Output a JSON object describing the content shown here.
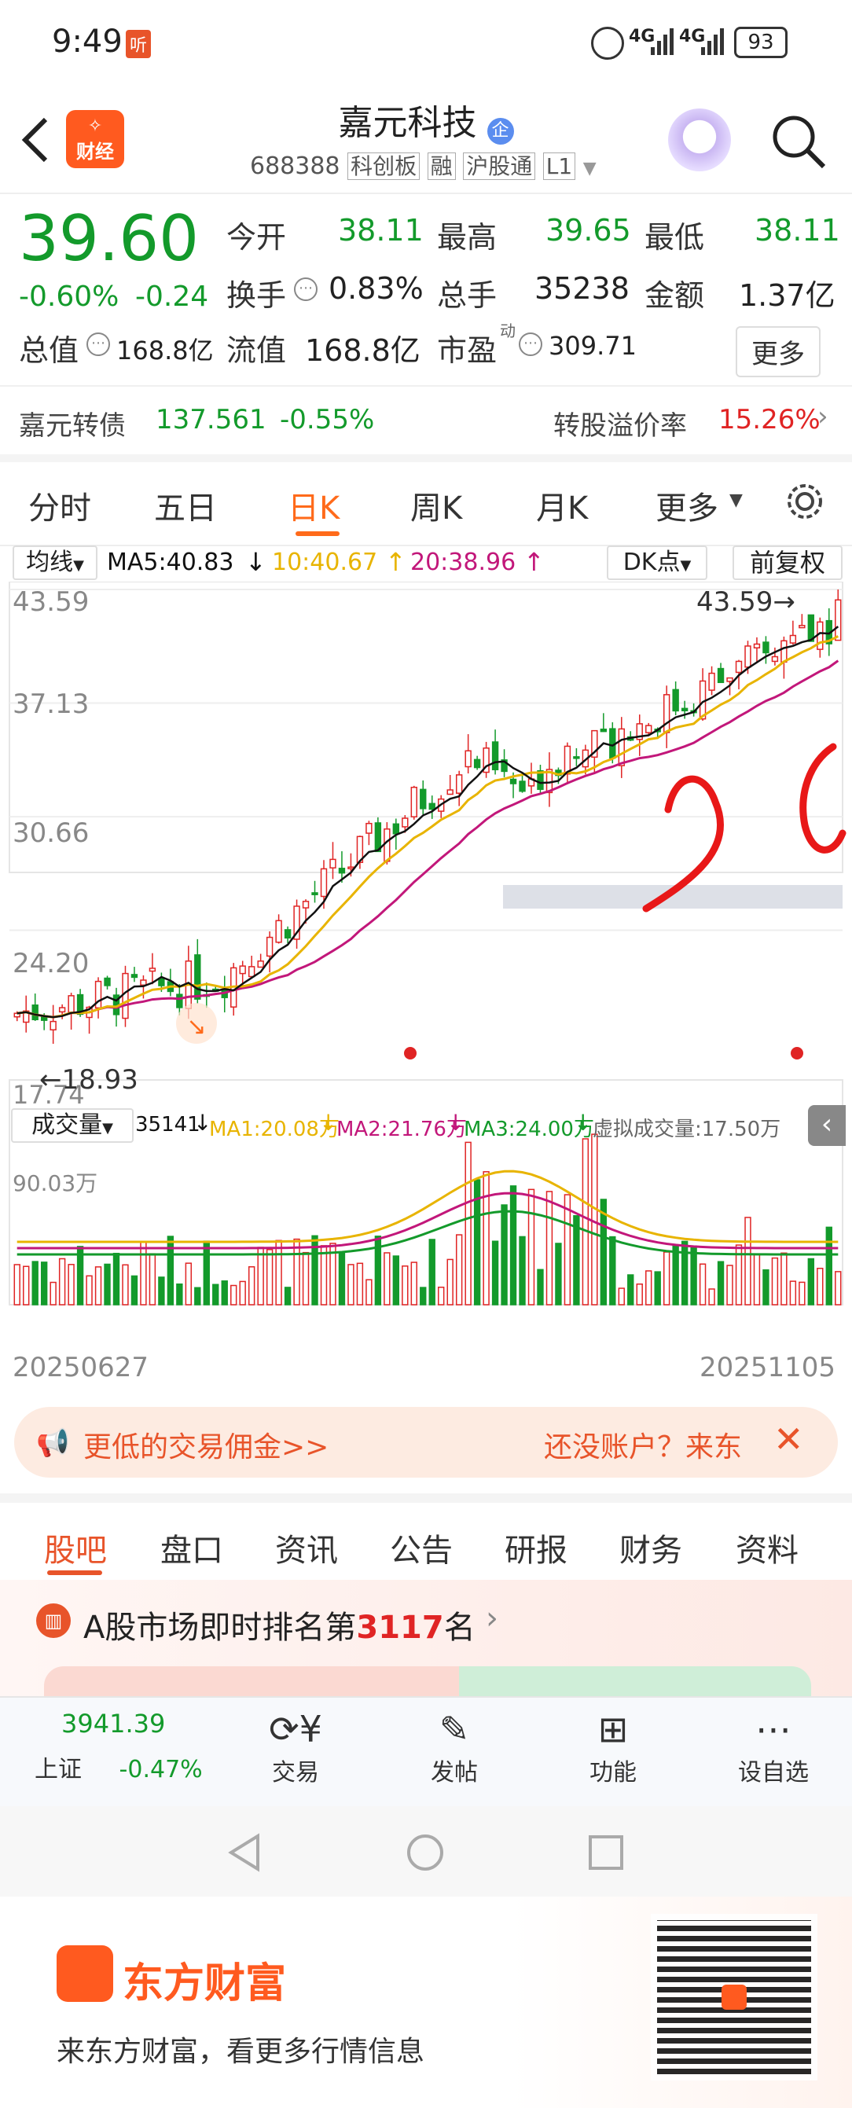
{
  "status_bar": {
    "time": "9:49",
    "badge": "听",
    "network1": "4G",
    "network2": "4G",
    "battery": "93"
  },
  "header": {
    "title": "嘉元科技",
    "company_badge": "企",
    "code": "688388",
    "tags": [
      "科创板",
      "融",
      "沪股通",
      "L1"
    ]
  },
  "quote": {
    "price": "39.60",
    "change_pct": "-0.60%",
    "change": "-0.24",
    "open_label": "今开",
    "open": "38.11",
    "high_label": "最高",
    "high": "39.65",
    "low_label": "最低",
    "low": "38.11",
    "turnover_label": "换手",
    "turnover": "0.83%",
    "volume_label": "总手",
    "volume": "35238",
    "amount_label": "金额",
    "amount": "1.37亿",
    "mcap_label": "总值",
    "mcap": "168.8亿",
    "float_label": "流值",
    "float": "168.8亿",
    "pe_label": "市盈",
    "pe_sup": "动",
    "pe": "309.71",
    "more": "更多"
  },
  "bond": {
    "name": "嘉元转债",
    "price": "137.561",
    "change": "-0.55%",
    "premium_label": "转股溢价率",
    "premium": "15.26%"
  },
  "ktabs": [
    "分时",
    "五日",
    "日K",
    "周K",
    "月K",
    "更多"
  ],
  "ktabs_active": 2,
  "chart": {
    "ma_selector": "均线",
    "ma5": "MA5:40.83",
    "ma10": "10:40.67",
    "ma20": "20:38.96",
    "dk": "DK点",
    "adjust": "前复权",
    "y_ticks": [
      "43.59",
      "37.13",
      "30.66",
      "24.20"
    ],
    "low_label": "17.74",
    "low_marker": "18.93",
    "high_marker": "43.59",
    "vol_selector": "成交量",
    "vol_now": "35141",
    "vol_ma1": "MA1:20.08万",
    "vol_ma2": "MA2:21.76万",
    "vol_ma3": "MA3:24.00万",
    "vol_virtual": "虚拟成交量:17.50万",
    "vol_max": "90.03万",
    "date_start": "20250627",
    "date_end": "20251105"
  },
  "chart_data": {
    "type": "candlestick",
    "x_range": [
      "20250627",
      "20251105"
    ],
    "ylim": [
      17.74,
      43.59
    ],
    "y_ticks": [
      43.59,
      37.13,
      30.66,
      24.2
    ],
    "series": [
      {
        "name": "MA5",
        "value": 40.83
      },
      {
        "name": "MA10",
        "value": 40.67
      },
      {
        "name": "MA20",
        "value": 38.96
      }
    ],
    "annotations": [
      "17.74",
      "18.93",
      "43.59"
    ],
    "volume_max": "90.03万",
    "colors": {
      "up": "#e02424",
      "down": "#139a2b",
      "ma5": "#111111",
      "ma10": "#e8b400",
      "ma20": "#c2177a"
    }
  },
  "ad": {
    "left": "更低的交易佣金>>",
    "right": "还没账户？来东"
  },
  "btabs": [
    "股吧",
    "盘口",
    "资讯",
    "公告",
    "研报",
    "财务",
    "资料"
  ],
  "btabs_active": 0,
  "rank": {
    "prefix": "A股市场即时排名第",
    "num": "3117",
    "suffix": "名"
  },
  "footer": {
    "index_value": "3941.39",
    "index_name": "上证",
    "index_change": "-0.47%",
    "items": [
      "交易",
      "发帖",
      "功能",
      "设自选"
    ]
  },
  "promo": {
    "brand": "东方财富",
    "slogan": "来东方财富，看更多行情信息"
  },
  "colors": {
    "up": "#e02424",
    "down": "#139a2b",
    "accent": "#ff6a1a"
  }
}
